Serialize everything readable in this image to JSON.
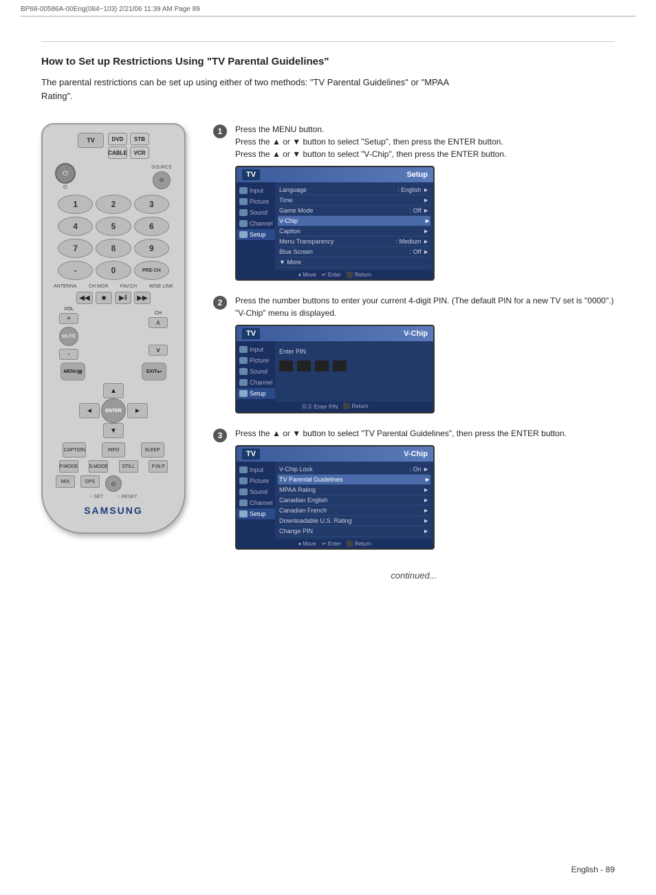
{
  "header": {
    "left_text": "BP68-00586A-00Eng(084~103)  2/21/06  11:39 AM  Page 89",
    "right_text": ""
  },
  "page": {
    "title": "How to Set up Restrictions Using \"TV Parental Guidelines\"",
    "intro": "The parental restrictions can be set up using either of two methods: \"TV Parental Guidelines\" or \"MPAA Rating\".",
    "continued": "continued...",
    "page_number": "English - 89"
  },
  "steps": [
    {
      "number": "1",
      "text": "Press the MENU button.\nPress the ▲ or ▼ button to select \"Setup\", then press the ENTER button.\nPress the ▲ or ▼ button to select \"V-Chip\", then press the ENTER button."
    },
    {
      "number": "2",
      "text": "Press the number buttons to enter your current 4-digit PIN. (The default PIN for a new TV set is \"0000\".) \"V-Chip\" menu is displayed."
    },
    {
      "number": "3",
      "text": "Press the ▲ or ▼ button to select \"TV Parental Guidelines\", then press the ENTER button."
    }
  ],
  "remote": {
    "label": "Samsung Remote Control",
    "buttons": {
      "tv": "TV",
      "dvd": "DVD",
      "stb": "STB",
      "cable": "CABLE",
      "vcr": "VCR",
      "power": "⏻",
      "source": "SOURCE",
      "numbers": [
        "1",
        "2",
        "3",
        "4",
        "5",
        "6",
        "7",
        "8",
        "9",
        "-",
        "0"
      ],
      "labels": [
        "ANTENNA",
        "CH MGR",
        "FAV.CH",
        "WISE LINK"
      ],
      "rew": "◀◀",
      "stop": "■",
      "play": "▶||",
      "ff": "▶▶",
      "vol_up": "+",
      "vol_down": "-",
      "mute": "MUTE",
      "ch_up": "∧",
      "ch_down": "∨",
      "menu": "MENU",
      "exit": "EXIT",
      "enter": "ENTER",
      "up": "▲",
      "down": "▼",
      "left": "◄",
      "right": "►",
      "caption": "CAPTION",
      "info": "INFO",
      "sleep": "SLEEP",
      "pmode": "P.MODE",
      "smode": "S.MODE",
      "still": "STILL",
      "pip": "P.IN.P",
      "mix": "MIX",
      "dps": "DPS",
      "set": "○ SET",
      "reset": "○ RESET",
      "samsung": "SAMSUNG"
    }
  },
  "screens": {
    "screen1": {
      "header_left": "TV",
      "header_right": "Setup",
      "sidebar": [
        "Input",
        "Picture",
        "Sound",
        "Channel",
        "Setup"
      ],
      "menu_items": [
        {
          "label": "Language",
          "value": ": English",
          "arrow": "►"
        },
        {
          "label": "Time",
          "value": "",
          "arrow": "►"
        },
        {
          "label": "Game Mode",
          "value": ": Off",
          "arrow": "►"
        },
        {
          "label": "V-Chip",
          "value": "",
          "arrow": "►",
          "highlighted": true
        },
        {
          "label": "Caption",
          "value": "",
          "arrow": "►"
        },
        {
          "label": "Menu Transparency",
          "value": ": Medium",
          "arrow": "►"
        },
        {
          "label": "Blue Screen",
          "value": ": Off",
          "arrow": "►"
        },
        {
          "label": "▼ More",
          "value": "",
          "arrow": ""
        }
      ],
      "footer": "♦ Move  ↵ Enter  ⬛ Return"
    },
    "screen2": {
      "header_left": "TV",
      "header_right": "V-Chip",
      "sidebar": [
        "Input",
        "Picture",
        "Sound",
        "Channel",
        "Setup"
      ],
      "label": "Enter PIN",
      "footer": "⓪② Enter PIN  ⬛ Return"
    },
    "screen3": {
      "header_left": "TV",
      "header_right": "V-Chip",
      "sidebar": [
        "Input",
        "Picture",
        "Sound",
        "Channel",
        "Setup"
      ],
      "menu_items": [
        {
          "label": "V-Chip Lock",
          "value": ": On",
          "arrow": "►"
        },
        {
          "label": "TV Parental Guidelines",
          "value": "",
          "arrow": "►",
          "highlighted": true
        },
        {
          "label": "MPAA Rating",
          "value": "",
          "arrow": "►"
        },
        {
          "label": "Canadian English",
          "value": "",
          "arrow": "►"
        },
        {
          "label": "Canadian French",
          "value": "",
          "arrow": "►"
        },
        {
          "label": "Downloadable U.S. Rating",
          "value": "",
          "arrow": "►"
        },
        {
          "label": "Change PIN",
          "value": "",
          "arrow": "►"
        }
      ],
      "footer": "♦ Move  ↵ Enter  ⬛ Return"
    }
  }
}
